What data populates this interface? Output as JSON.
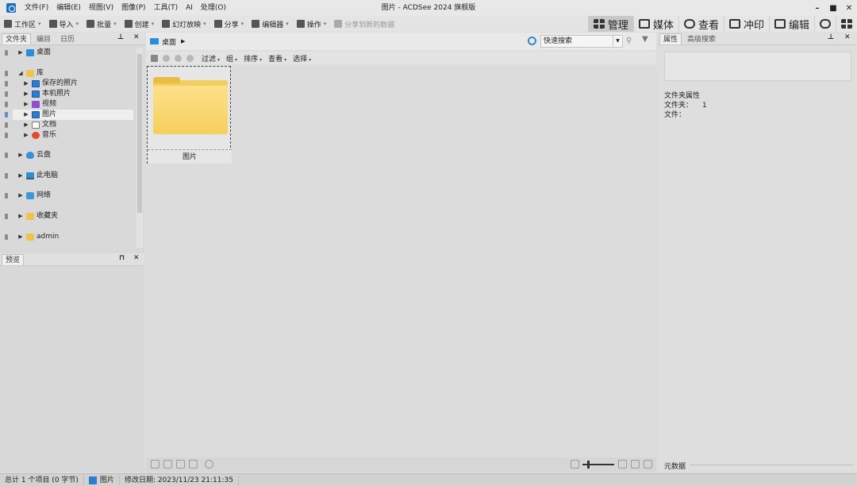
{
  "window": {
    "title": "图片 - ACDSee 2024 旗舰版",
    "menu": [
      "文件(F)",
      "编辑(E)",
      "视图(V)",
      "图像(P)",
      "工具(T)",
      "AI",
      "处理(O)"
    ],
    "controls": {
      "minimize": "–",
      "maximize": "■",
      "close": "✕"
    }
  },
  "toolbar": {
    "items": [
      {
        "label": "工作区",
        "icon": "workspace-icon",
        "caret": "▾"
      },
      {
        "label": "导入",
        "icon": "import-icon",
        "caret": "▾"
      },
      {
        "label": "批量",
        "icon": "batch-icon",
        "caret": "▾"
      },
      {
        "label": "创建",
        "icon": "create-icon",
        "caret": "▾"
      },
      {
        "label": "幻灯放映",
        "icon": "slideshow-icon",
        "caret": "▾"
      },
      {
        "label": "分享",
        "icon": "share-icon",
        "caret": "▾"
      },
      {
        "label": "编辑器",
        "icon": "editor-icon",
        "caret": "▾"
      },
      {
        "label": "操作",
        "icon": "actions-icon",
        "caret": "▾"
      },
      {
        "label": "分享到新的数据",
        "icon": "share-data-icon",
        "caret": ""
      }
    ],
    "modes": [
      {
        "label": "管理",
        "icon": "manage-grid-icon",
        "active": true
      },
      {
        "label": "媒体",
        "icon": "media-icon",
        "active": false
      },
      {
        "label": "查看",
        "icon": "view-eye-icon",
        "active": false
      },
      {
        "label": "冲印",
        "icon": "develop-icon",
        "active": false
      },
      {
        "label": "编辑",
        "icon": "edit-tools-icon",
        "active": false
      },
      {
        "label": "",
        "icon": "365-icon",
        "active": false
      },
      {
        "label": "",
        "icon": "dashboard-icon",
        "active": false
      }
    ]
  },
  "left_panel": {
    "tabs": [
      "文件夹",
      "编目",
      "日历"
    ],
    "pin": "⊥",
    "close": "✕",
    "tree": [
      {
        "label": "桌面",
        "icon": "desktop-icon",
        "arrow": "▶"
      },
      {
        "label": "库",
        "icon": "folder-icon",
        "arrow": "◢"
      },
      {
        "label": "保存的照片",
        "icon": "picture-icon",
        "arrow": "▶"
      },
      {
        "label": "本机照片",
        "icon": "picture-icon",
        "arrow": "▶"
      },
      {
        "label": "视频",
        "icon": "video-icon",
        "arrow": "▶"
      },
      {
        "label": "图片",
        "icon": "picture-icon",
        "arrow": "▶"
      },
      {
        "label": "文档",
        "icon": "document-icon",
        "arrow": "▶"
      },
      {
        "label": "音乐",
        "icon": "music-icon",
        "arrow": "▶"
      },
      {
        "label": "云盘",
        "icon": "cloud-icon",
        "arrow": "▶"
      },
      {
        "label": "此电脑",
        "icon": "computer-icon",
        "arrow": "▶"
      },
      {
        "label": "网络",
        "icon": "network-icon",
        "arrow": "▶"
      },
      {
        "label": "收藏夹",
        "icon": "folder-icon",
        "arrow": "▶"
      },
      {
        "label": "admin",
        "icon": "folder-icon",
        "arrow": "▶"
      }
    ],
    "preview_tab": "预览",
    "preview_pin": "⊓",
    "preview_close": "✕"
  },
  "center": {
    "path": "桌面",
    "path_arrow": "▶",
    "quick_search": "快速搜索",
    "nav": [
      {
        "label": "过滤",
        "caret": "▾"
      },
      {
        "label": "组",
        "caret": "▾"
      },
      {
        "label": "排序",
        "caret": "▾"
      },
      {
        "label": "查看",
        "caret": "▾"
      },
      {
        "label": "选择",
        "caret": "▾"
      }
    ],
    "items": [
      {
        "label": "图片",
        "type": "folder"
      }
    ]
  },
  "right_panel": {
    "tabs": [
      "属性",
      "高级搜索"
    ],
    "pin": "⊥",
    "close": "✕",
    "heading": "文件夹属性",
    "rows": [
      {
        "key": "文件夹：",
        "value": "1"
      },
      {
        "key": "文件：",
        "value": ""
      }
    ],
    "bottom_label": "元数据"
  },
  "status": {
    "total": "总计 1 个项目 (0 字节)",
    "item": "图片",
    "modified": "修改日期: 2023/11/23 21:11:35"
  }
}
